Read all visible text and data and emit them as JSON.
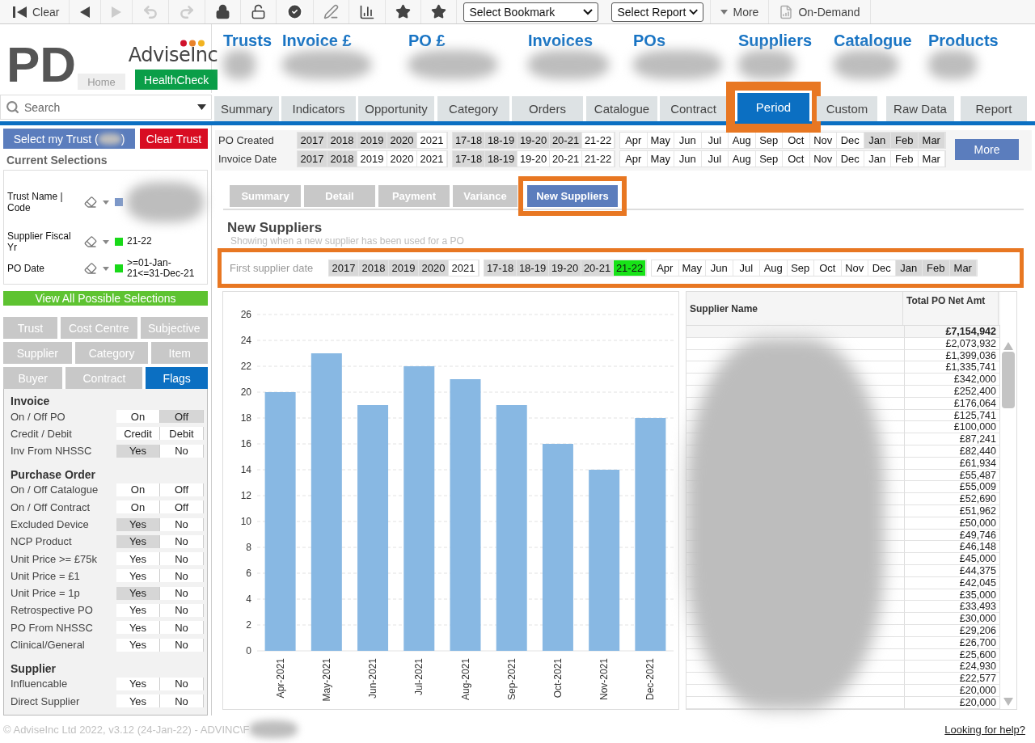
{
  "toolbar": {
    "clear": "Clear",
    "bookmark_select": "Select Bookmark",
    "report_select": "Select Report",
    "more": "More",
    "on_demand": "On-Demand"
  },
  "header": {
    "app_initials": "PD",
    "home": "Home",
    "logo": "AdviseInc",
    "healthcheck": "HealthCheck",
    "kpis": [
      "Trusts",
      "Invoice £",
      "PO £",
      "Invoices",
      "POs",
      "Suppliers",
      "Catalogue",
      "Products"
    ]
  },
  "search": {
    "placeholder": "Search"
  },
  "tabs": [
    {
      "label": "Summary",
      "selected": false
    },
    {
      "label": "Indicators",
      "selected": false
    },
    {
      "label": "Opportunity",
      "selected": false
    },
    {
      "label": "Category",
      "selected": false
    },
    {
      "label": "Orders",
      "selected": false
    },
    {
      "label": "Catalogue",
      "selected": false
    },
    {
      "label": "Contract",
      "selected": false
    },
    {
      "label": "Period",
      "selected": true,
      "highlighted": true
    },
    {
      "label": "Custom",
      "selected": false
    },
    {
      "label": "Raw Data",
      "selected": false
    },
    {
      "label": "Report",
      "selected": false
    }
  ],
  "sidebar": {
    "select_trust": "Select my Trust (",
    "select_trust_end": ")",
    "clear_trust": "Clear Trust",
    "current_selections_title": "Current Selections",
    "selections": [
      {
        "label": "Trust Name | Code",
        "color": "#7b97c9",
        "redacted": true
      },
      {
        "label": "Supplier Fiscal Yr",
        "color": "#19d919",
        "value": "21-22"
      },
      {
        "label": "PO Date",
        "color": "#19d919",
        "value": ">=01-Jan-21<=31-Dec-21"
      }
    ],
    "view_all": "View All Possible Selections",
    "list_tabs": [
      [
        {
          "label": "Trust",
          "selected": false
        },
        {
          "label": "Cost Centre",
          "selected": false
        },
        {
          "label": "Subjective",
          "selected": false
        }
      ],
      [
        {
          "label": "Supplier",
          "selected": false
        },
        {
          "label": "Category",
          "selected": false
        },
        {
          "label": "Item",
          "selected": false
        }
      ],
      [
        {
          "label": "Buyer",
          "selected": false
        },
        {
          "label": "Contract",
          "selected": false
        },
        {
          "label": "Flags",
          "selected": true
        }
      ]
    ],
    "flag_sections": [
      {
        "title": "Invoice",
        "rows": [
          {
            "label": "On / Off PO",
            "options": [
              {
                "label": "On",
                "excluded": false
              },
              {
                "label": "Off",
                "excluded": true
              }
            ]
          },
          {
            "label": "Credit / Debit",
            "options": [
              {
                "label": "Credit",
                "excluded": false
              },
              {
                "label": "Debit",
                "excluded": false
              }
            ]
          },
          {
            "label": "Inv From NHSSC",
            "options": [
              {
                "label": "Yes",
                "excluded": true
              },
              {
                "label": "No",
                "excluded": false
              }
            ]
          }
        ]
      },
      {
        "title": "Purchase Order",
        "rows": [
          {
            "label": "On / Off Catalogue",
            "options": [
              {
                "label": "On",
                "excluded": false
              },
              {
                "label": "Off",
                "excluded": false
              }
            ]
          },
          {
            "label": "On / Off Contract",
            "options": [
              {
                "label": "On",
                "excluded": false
              },
              {
                "label": "Off",
                "excluded": false
              }
            ]
          },
          {
            "label": "Excluded Device",
            "options": [
              {
                "label": "Yes",
                "excluded": true
              },
              {
                "label": "No",
                "excluded": false
              }
            ]
          },
          {
            "label": "NCP Product",
            "options": [
              {
                "label": "Yes",
                "excluded": true
              },
              {
                "label": "No",
                "excluded": false
              }
            ]
          },
          {
            "label": "Unit Price >= £75k",
            "options": [
              {
                "label": "Yes",
                "excluded": false
              },
              {
                "label": "No",
                "excluded": false
              }
            ]
          },
          {
            "label": "Unit Price = £1",
            "options": [
              {
                "label": "Yes",
                "excluded": false
              },
              {
                "label": "No",
                "excluded": false
              }
            ]
          },
          {
            "label": "Unit Price = 1p",
            "options": [
              {
                "label": "Yes",
                "excluded": true
              },
              {
                "label": "No",
                "excluded": false
              }
            ]
          },
          {
            "label": "Retrospective PO",
            "options": [
              {
                "label": "Yes",
                "excluded": false
              },
              {
                "label": "No",
                "excluded": false
              }
            ]
          },
          {
            "label": "PO From NHSSC",
            "options": [
              {
                "label": "Yes",
                "excluded": false
              },
              {
                "label": "No",
                "excluded": false
              }
            ]
          },
          {
            "label": "Clinical/General",
            "options": [
              {
                "label": "Yes",
                "excluded": false
              },
              {
                "label": "No",
                "excluded": false
              }
            ]
          }
        ]
      },
      {
        "title": "Supplier",
        "rows": [
          {
            "label": "Influencable",
            "options": [
              {
                "label": "Yes",
                "excluded": false
              },
              {
                "label": "No",
                "excluded": false
              }
            ]
          },
          {
            "label": "Direct Supplier",
            "options": [
              {
                "label": "Yes",
                "excluded": false
              },
              {
                "label": "No",
                "excluded": false
              }
            ]
          }
        ]
      }
    ]
  },
  "period_filters": [
    {
      "label": "PO Created",
      "groups": [
        [
          {
            "label": "2017",
            "excluded": true,
            "selected": false
          },
          {
            "label": "2018",
            "excluded": true,
            "selected": false
          },
          {
            "label": "2019",
            "excluded": true,
            "selected": false
          },
          {
            "label": "2020",
            "excluded": true,
            "selected": false
          },
          {
            "label": "2021",
            "excluded": false,
            "selected": false
          }
        ],
        [
          {
            "label": "17-18",
            "excluded": true,
            "selected": false
          },
          {
            "label": "18-19",
            "excluded": true,
            "selected": false
          },
          {
            "label": "19-20",
            "excluded": true,
            "selected": false
          },
          {
            "label": "20-21",
            "excluded": true,
            "selected": false
          },
          {
            "label": "21-22",
            "excluded": false,
            "selected": false
          }
        ],
        [
          {
            "label": "Apr",
            "excluded": false,
            "selected": false
          },
          {
            "label": "May",
            "excluded": false,
            "selected": false
          },
          {
            "label": "Jun",
            "excluded": false,
            "selected": false
          },
          {
            "label": "Jul",
            "excluded": false,
            "selected": false
          },
          {
            "label": "Aug",
            "excluded": false,
            "selected": false
          },
          {
            "label": "Sep",
            "excluded": false,
            "selected": false
          },
          {
            "label": "Oct",
            "excluded": false,
            "selected": false
          },
          {
            "label": "Nov",
            "excluded": false,
            "selected": false
          },
          {
            "label": "Dec",
            "excluded": false,
            "selected": false
          },
          {
            "label": "Jan",
            "excluded": true,
            "selected": false
          },
          {
            "label": "Feb",
            "excluded": true,
            "selected": false
          },
          {
            "label": "Mar",
            "excluded": true,
            "selected": false
          }
        ]
      ]
    },
    {
      "label": "Invoice Date",
      "groups": [
        [
          {
            "label": "2017",
            "excluded": true,
            "selected": false
          },
          {
            "label": "2018",
            "excluded": true,
            "selected": false
          },
          {
            "label": "2019",
            "excluded": false,
            "selected": false
          },
          {
            "label": "2020",
            "excluded": false,
            "selected": false
          },
          {
            "label": "2021",
            "excluded": false,
            "selected": false
          }
        ],
        [
          {
            "label": "17-18",
            "excluded": true,
            "selected": false
          },
          {
            "label": "18-19",
            "excluded": true,
            "selected": false
          },
          {
            "label": "19-20",
            "excluded": false,
            "selected": false
          },
          {
            "label": "20-21",
            "excluded": false,
            "selected": false
          },
          {
            "label": "21-22",
            "excluded": false,
            "selected": false
          }
        ],
        [
          {
            "label": "Apr",
            "excluded": false,
            "selected": false
          },
          {
            "label": "May",
            "excluded": false,
            "selected": false
          },
          {
            "label": "Jun",
            "excluded": false,
            "selected": false
          },
          {
            "label": "Jul",
            "excluded": false,
            "selected": false
          },
          {
            "label": "Aug",
            "excluded": false,
            "selected": false
          },
          {
            "label": "Sep",
            "excluded": false,
            "selected": false
          },
          {
            "label": "Oct",
            "excluded": false,
            "selected": false
          },
          {
            "label": "Nov",
            "excluded": false,
            "selected": false
          },
          {
            "label": "Dec",
            "excluded": false,
            "selected": false
          },
          {
            "label": "Jan",
            "excluded": false,
            "selected": false
          },
          {
            "label": "Feb",
            "excluded": false,
            "selected": false
          },
          {
            "label": "Mar",
            "excluded": false,
            "selected": false
          }
        ]
      ]
    }
  ],
  "more_button": "More",
  "subtabs": [
    {
      "label": "Summary",
      "selected": false
    },
    {
      "label": "Detail",
      "selected": false
    },
    {
      "label": "Payment",
      "selected": false
    },
    {
      "label": "Variance",
      "selected": false
    },
    {
      "label": "New Suppliers",
      "selected": true,
      "highlighted": true
    }
  ],
  "section": {
    "title": "New Suppliers",
    "subtitle": "Showing when a new supplier has been used for a PO",
    "filter": {
      "label": "First supplier date",
      "highlighted": true,
      "groups": [
        [
          {
            "label": "2017",
            "excluded": true,
            "selected": false
          },
          {
            "label": "2018",
            "excluded": true,
            "selected": false
          },
          {
            "label": "2019",
            "excluded": true,
            "selected": false
          },
          {
            "label": "2020",
            "excluded": true,
            "selected": false
          },
          {
            "label": "2021",
            "excluded": false,
            "selected": false
          }
        ],
        [
          {
            "label": "17-18",
            "excluded": true,
            "selected": false
          },
          {
            "label": "18-19",
            "excluded": true,
            "selected": false
          },
          {
            "label": "19-20",
            "excluded": true,
            "selected": false
          },
          {
            "label": "20-21",
            "excluded": true,
            "selected": false
          },
          {
            "label": "21-22",
            "excluded": false,
            "selected": true
          }
        ],
        [
          {
            "label": "Apr",
            "excluded": false,
            "selected": false
          },
          {
            "label": "May",
            "excluded": false,
            "selected": false
          },
          {
            "label": "Jun",
            "excluded": false,
            "selected": false
          },
          {
            "label": "Jul",
            "excluded": false,
            "selected": false
          },
          {
            "label": "Aug",
            "excluded": false,
            "selected": false
          },
          {
            "label": "Sep",
            "excluded": false,
            "selected": false
          },
          {
            "label": "Oct",
            "excluded": false,
            "selected": false
          },
          {
            "label": "Nov",
            "excluded": false,
            "selected": false
          },
          {
            "label": "Dec",
            "excluded": false,
            "selected": false
          },
          {
            "label": "Jan",
            "excluded": true,
            "selected": false
          },
          {
            "label": "Feb",
            "excluded": true,
            "selected": false
          },
          {
            "label": "Mar",
            "excluded": true,
            "selected": false
          }
        ]
      ]
    },
    "chart_data": {
      "type": "bar",
      "categories": [
        "Apr-2021",
        "May-2021",
        "Jun-2021",
        "Jul-2021",
        "Aug-2021",
        "Sep-2021",
        "Oct-2021",
        "Nov-2021",
        "Dec-2021"
      ],
      "series": [
        {
          "color": "#88b8e3",
          "values": [
            20,
            23,
            19,
            22,
            21,
            19,
            16,
            14,
            18
          ]
        }
      ],
      "ylim": [
        0,
        26
      ],
      "grid": true,
      "yticks": [
        0,
        2,
        4,
        6,
        8,
        10,
        12,
        14,
        16,
        18,
        20,
        22,
        24,
        26
      ]
    },
    "table": {
      "columns": [
        "Supplier Name",
        "Total PO Net Amt"
      ],
      "total": "£7,154,942",
      "values": [
        "£2,073,932",
        "£1,399,036",
        "£1,335,741",
        "£342,000",
        "£252,400",
        "£176,064",
        "£125,741",
        "£100,000",
        "£87,241",
        "£82,440",
        "£61,934",
        "£55,487",
        "£55,009",
        "£52,690",
        "£51,962",
        "£50,000",
        "£49,746",
        "£46,148",
        "£45,000",
        "£44,375",
        "£42,045",
        "£35,000",
        "£33,493",
        "£30,000",
        "£29,206",
        "£26,700",
        "£25,600",
        "£24,930",
        "£22,577",
        "£20,000",
        "£20,000"
      ]
    }
  },
  "footer": {
    "copyright": "© AdviseInc Ltd 2022, v3.12 (24-Jan-22) - ADVINC\\F",
    "help": "Looking for help?"
  }
}
